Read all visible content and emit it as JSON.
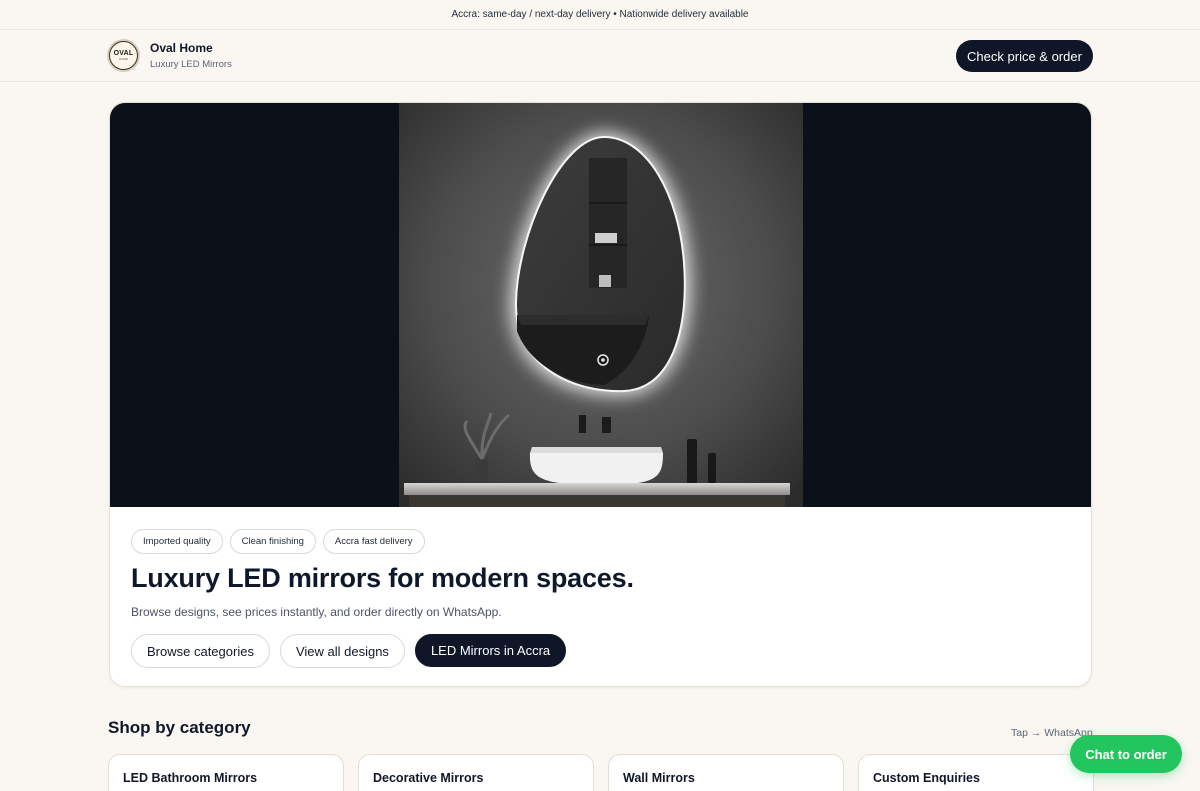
{
  "announcement": "Accra: same-day / next-day delivery • Nationwide delivery available",
  "brand": {
    "logo_text": "OVAL",
    "logo_sub": "HOME",
    "name": "Oval Home",
    "tagline": "Luxury LED Mirrors"
  },
  "header": {
    "cta_label": "Check price & order"
  },
  "hero": {
    "image_alt": "egg-shaped-led-mirror-bathroom",
    "chips": [
      "Imported quality",
      "Clean finishing",
      "Accra fast delivery"
    ],
    "title": "Luxury LED mirrors for modern spaces.",
    "subtitle": "Browse designs, see prices instantly, and order directly on WhatsApp.",
    "buttons": {
      "browse": "Browse categories",
      "view_all": "View all designs",
      "accra": "LED Mirrors in Accra"
    }
  },
  "shop": {
    "title": "Shop by category",
    "hint": "Tap → WhatsApp",
    "categories": [
      "LED Bathroom Mirrors",
      "Decorative Mirrors",
      "Wall Mirrors",
      "Custom Enquiries"
    ]
  },
  "floating": {
    "chat_label": "Chat to order"
  },
  "colors": {
    "background": "#faf7f2",
    "primary_dark": "#0e1628",
    "whatsapp_green": "#22c55e"
  }
}
